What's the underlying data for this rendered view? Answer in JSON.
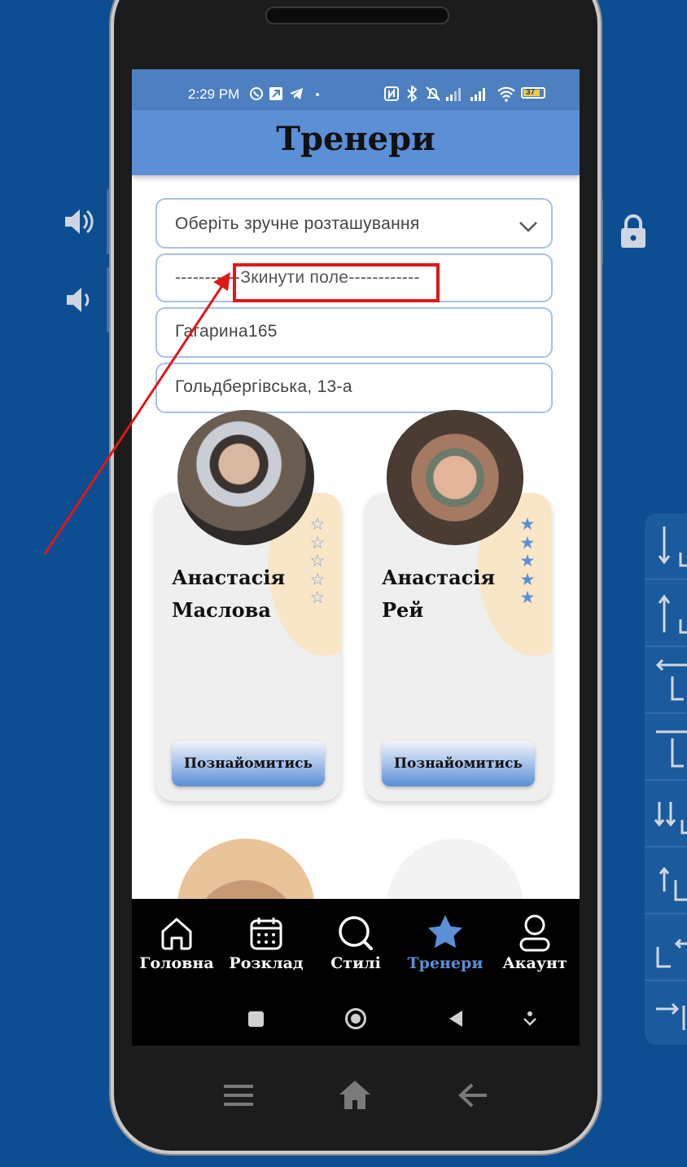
{
  "status_bar": {
    "time": "2:29 PM",
    "battery": "37"
  },
  "header": {
    "title": "Тренери"
  },
  "location_select": {
    "selected": "Оберіть зручне розташування"
  },
  "location_options": [
    "-----------Зкинути поле------------",
    "Гагарина165",
    "Гольдбергівська, 13-а"
  ],
  "trainers": [
    {
      "first_name": "Анастасія",
      "last_name": "Маслова",
      "rating": 0,
      "button": "Познайомитись"
    },
    {
      "first_name": "Анастасія",
      "last_name": "Рей",
      "rating": 5,
      "button": "Познайомитись"
    }
  ],
  "bottom_nav": [
    {
      "label": "Головна",
      "icon": "home-icon"
    },
    {
      "label": "Розклад",
      "icon": "calendar-icon"
    },
    {
      "label": "Стилі",
      "icon": "search-icon"
    },
    {
      "label": "Тренери",
      "icon": "star-icon",
      "active": true
    },
    {
      "label": "Акаунт",
      "icon": "user-icon"
    }
  ],
  "colors": {
    "background": "#0d4e92",
    "header": "#5b8fd6",
    "active_nav": "#5b8fd6",
    "highlight_box": "#e01818"
  }
}
